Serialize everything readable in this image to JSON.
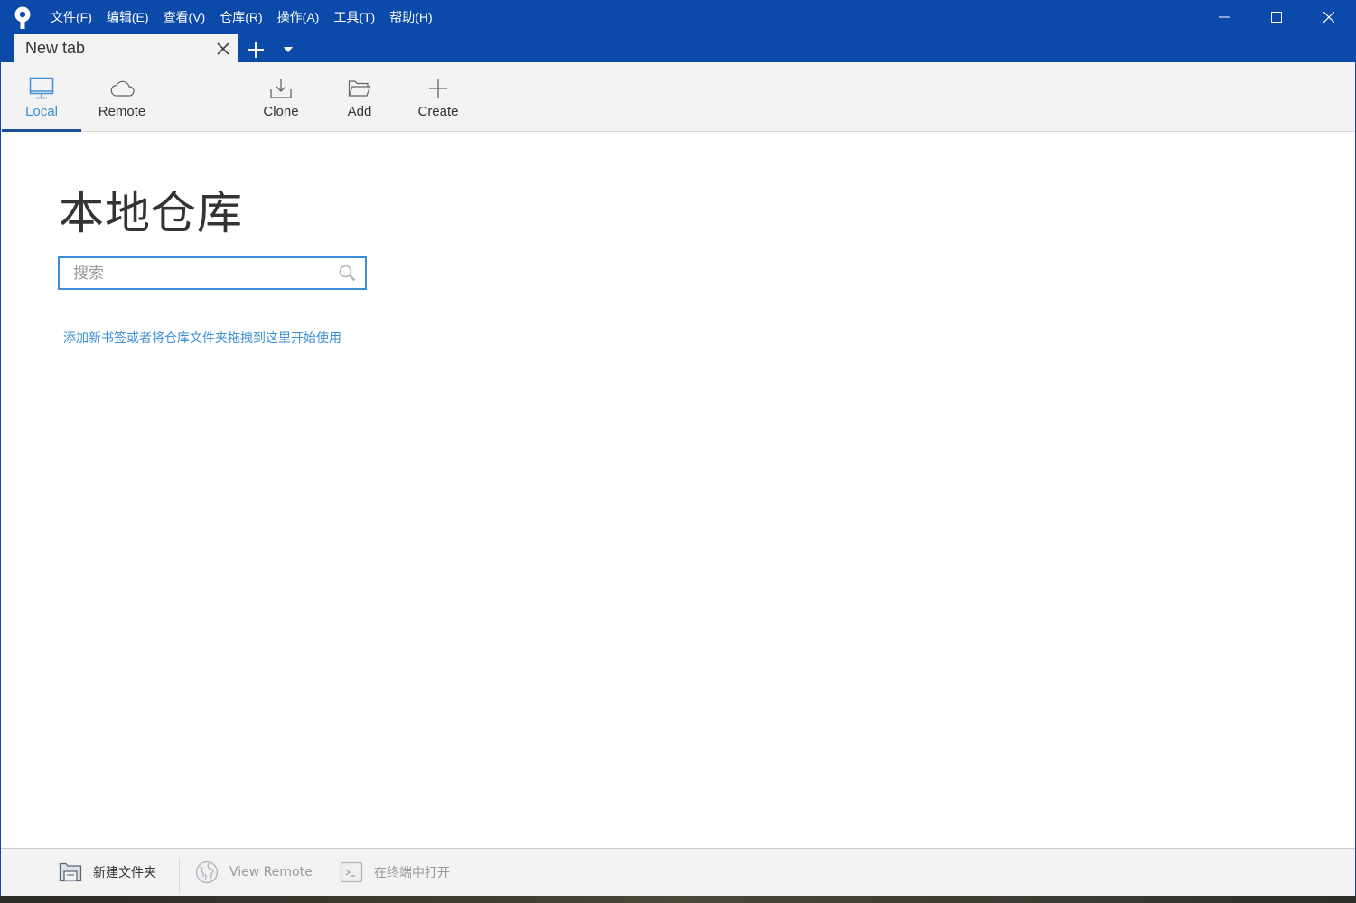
{
  "app": {
    "menu": [
      {
        "label": "文件(F)"
      },
      {
        "label": "编辑(E)"
      },
      {
        "label": "查看(V)"
      },
      {
        "label": "仓库(R)"
      },
      {
        "label": "操作(A)"
      },
      {
        "label": "工具(T)"
      },
      {
        "label": "帮助(H)"
      }
    ],
    "window_controls": {
      "minimize": "minimize-icon",
      "maximize": "maximize-icon",
      "close": "close-icon"
    },
    "accent_color": "#0b4aa8"
  },
  "tabs": [
    {
      "label": "New tab",
      "active": true
    }
  ],
  "toolbar": {
    "local_label": "Local",
    "remote_label": "Remote",
    "clone_label": "Clone",
    "add_label": "Add",
    "create_label": "Create",
    "active": "Local"
  },
  "main": {
    "title": "本地仓库",
    "search": {
      "placeholder": "搜索",
      "value": ""
    },
    "hint": "添加新书签或者将仓库文件夹拖拽到这里开始使用"
  },
  "bottombar": {
    "new_folder_label": "新建文件夹",
    "view_remote_label": "View Remote",
    "open_terminal_label": "在终端中打开",
    "view_remote_enabled": false,
    "open_terminal_enabled": false
  }
}
